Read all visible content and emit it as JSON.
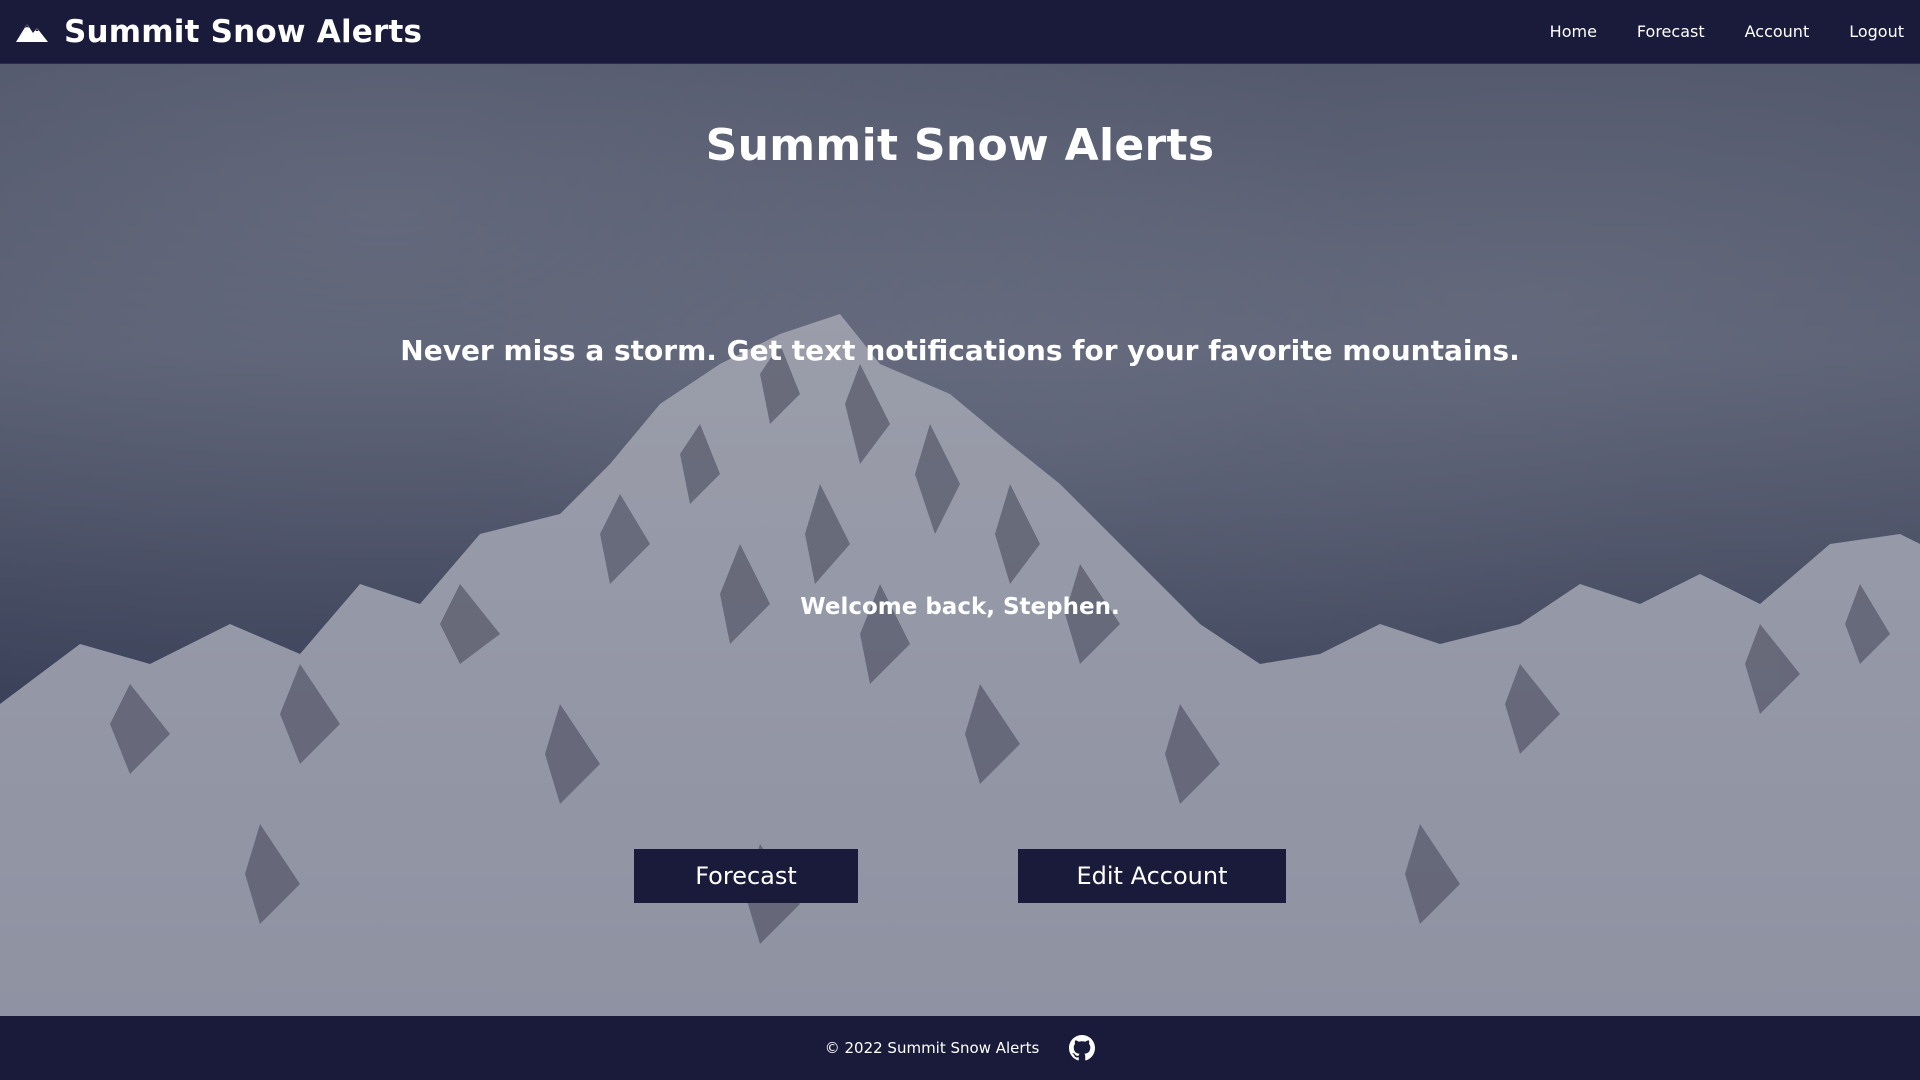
{
  "brand": {
    "icon": "mountain-icon",
    "title": "Summit Snow Alerts"
  },
  "nav": {
    "links": [
      {
        "label": "Home"
      },
      {
        "label": "Forecast"
      },
      {
        "label": "Account"
      },
      {
        "label": "Logout"
      }
    ]
  },
  "hero": {
    "title": "Summit Snow Alerts",
    "tagline": "Never miss a storm. Get text notifications for your favorite mountains.",
    "welcome": "Welcome back, Stephen.",
    "buttons": {
      "forecast": "Forecast",
      "edit_account": "Edit Account"
    }
  },
  "footer": {
    "copyright": "© 2022 Summit Snow Alerts",
    "icon": "github-icon"
  },
  "colors": {
    "navbar_bg": "#1a1b3a",
    "button_bg": "#1a1b3a",
    "text": "#ffffff"
  }
}
